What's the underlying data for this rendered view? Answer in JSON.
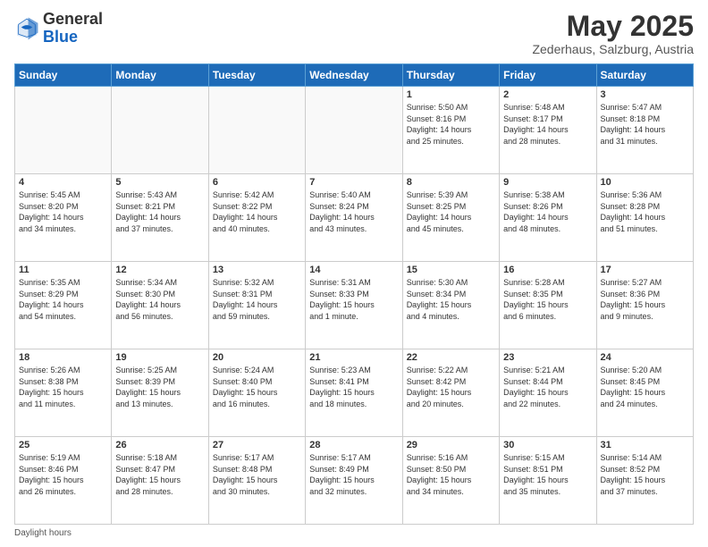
{
  "header": {
    "logo_general": "General",
    "logo_blue": "Blue",
    "month_title": "May 2025",
    "location": "Zederhaus, Salzburg, Austria"
  },
  "days_of_week": [
    "Sunday",
    "Monday",
    "Tuesday",
    "Wednesday",
    "Thursday",
    "Friday",
    "Saturday"
  ],
  "weeks": [
    [
      {
        "day": "",
        "info": ""
      },
      {
        "day": "",
        "info": ""
      },
      {
        "day": "",
        "info": ""
      },
      {
        "day": "",
        "info": ""
      },
      {
        "day": "1",
        "info": "Sunrise: 5:50 AM\nSunset: 8:16 PM\nDaylight: 14 hours\nand 25 minutes."
      },
      {
        "day": "2",
        "info": "Sunrise: 5:48 AM\nSunset: 8:17 PM\nDaylight: 14 hours\nand 28 minutes."
      },
      {
        "day": "3",
        "info": "Sunrise: 5:47 AM\nSunset: 8:18 PM\nDaylight: 14 hours\nand 31 minutes."
      }
    ],
    [
      {
        "day": "4",
        "info": "Sunrise: 5:45 AM\nSunset: 8:20 PM\nDaylight: 14 hours\nand 34 minutes."
      },
      {
        "day": "5",
        "info": "Sunrise: 5:43 AM\nSunset: 8:21 PM\nDaylight: 14 hours\nand 37 minutes."
      },
      {
        "day": "6",
        "info": "Sunrise: 5:42 AM\nSunset: 8:22 PM\nDaylight: 14 hours\nand 40 minutes."
      },
      {
        "day": "7",
        "info": "Sunrise: 5:40 AM\nSunset: 8:24 PM\nDaylight: 14 hours\nand 43 minutes."
      },
      {
        "day": "8",
        "info": "Sunrise: 5:39 AM\nSunset: 8:25 PM\nDaylight: 14 hours\nand 45 minutes."
      },
      {
        "day": "9",
        "info": "Sunrise: 5:38 AM\nSunset: 8:26 PM\nDaylight: 14 hours\nand 48 minutes."
      },
      {
        "day": "10",
        "info": "Sunrise: 5:36 AM\nSunset: 8:28 PM\nDaylight: 14 hours\nand 51 minutes."
      }
    ],
    [
      {
        "day": "11",
        "info": "Sunrise: 5:35 AM\nSunset: 8:29 PM\nDaylight: 14 hours\nand 54 minutes."
      },
      {
        "day": "12",
        "info": "Sunrise: 5:34 AM\nSunset: 8:30 PM\nDaylight: 14 hours\nand 56 minutes."
      },
      {
        "day": "13",
        "info": "Sunrise: 5:32 AM\nSunset: 8:31 PM\nDaylight: 14 hours\nand 59 minutes."
      },
      {
        "day": "14",
        "info": "Sunrise: 5:31 AM\nSunset: 8:33 PM\nDaylight: 15 hours\nand 1 minute."
      },
      {
        "day": "15",
        "info": "Sunrise: 5:30 AM\nSunset: 8:34 PM\nDaylight: 15 hours\nand 4 minutes."
      },
      {
        "day": "16",
        "info": "Sunrise: 5:28 AM\nSunset: 8:35 PM\nDaylight: 15 hours\nand 6 minutes."
      },
      {
        "day": "17",
        "info": "Sunrise: 5:27 AM\nSunset: 8:36 PM\nDaylight: 15 hours\nand 9 minutes."
      }
    ],
    [
      {
        "day": "18",
        "info": "Sunrise: 5:26 AM\nSunset: 8:38 PM\nDaylight: 15 hours\nand 11 minutes."
      },
      {
        "day": "19",
        "info": "Sunrise: 5:25 AM\nSunset: 8:39 PM\nDaylight: 15 hours\nand 13 minutes."
      },
      {
        "day": "20",
        "info": "Sunrise: 5:24 AM\nSunset: 8:40 PM\nDaylight: 15 hours\nand 16 minutes."
      },
      {
        "day": "21",
        "info": "Sunrise: 5:23 AM\nSunset: 8:41 PM\nDaylight: 15 hours\nand 18 minutes."
      },
      {
        "day": "22",
        "info": "Sunrise: 5:22 AM\nSunset: 8:42 PM\nDaylight: 15 hours\nand 20 minutes."
      },
      {
        "day": "23",
        "info": "Sunrise: 5:21 AM\nSunset: 8:44 PM\nDaylight: 15 hours\nand 22 minutes."
      },
      {
        "day": "24",
        "info": "Sunrise: 5:20 AM\nSunset: 8:45 PM\nDaylight: 15 hours\nand 24 minutes."
      }
    ],
    [
      {
        "day": "25",
        "info": "Sunrise: 5:19 AM\nSunset: 8:46 PM\nDaylight: 15 hours\nand 26 minutes."
      },
      {
        "day": "26",
        "info": "Sunrise: 5:18 AM\nSunset: 8:47 PM\nDaylight: 15 hours\nand 28 minutes."
      },
      {
        "day": "27",
        "info": "Sunrise: 5:17 AM\nSunset: 8:48 PM\nDaylight: 15 hours\nand 30 minutes."
      },
      {
        "day": "28",
        "info": "Sunrise: 5:17 AM\nSunset: 8:49 PM\nDaylight: 15 hours\nand 32 minutes."
      },
      {
        "day": "29",
        "info": "Sunrise: 5:16 AM\nSunset: 8:50 PM\nDaylight: 15 hours\nand 34 minutes."
      },
      {
        "day": "30",
        "info": "Sunrise: 5:15 AM\nSunset: 8:51 PM\nDaylight: 15 hours\nand 35 minutes."
      },
      {
        "day": "31",
        "info": "Sunrise: 5:14 AM\nSunset: 8:52 PM\nDaylight: 15 hours\nand 37 minutes."
      }
    ]
  ],
  "footer": {
    "daylight_label": "Daylight hours"
  }
}
